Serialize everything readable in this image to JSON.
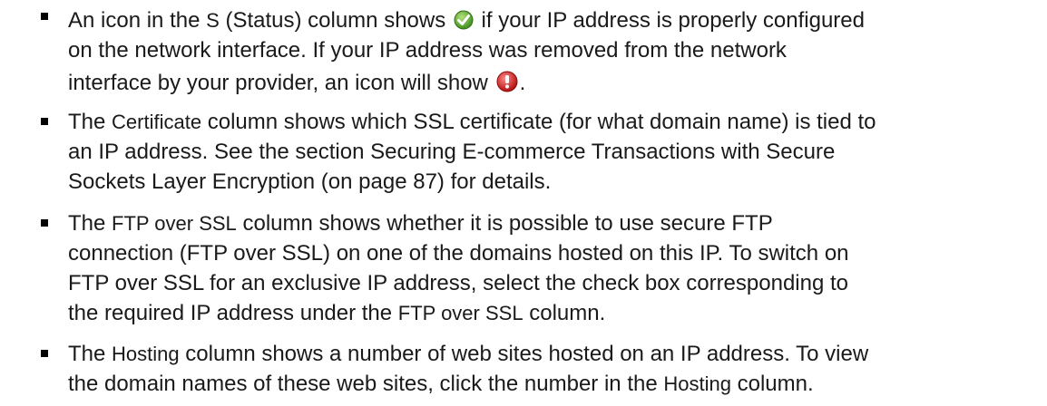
{
  "colors": {
    "ok_icon": "#5aa82e",
    "error_icon": "#cc1b1b"
  },
  "icons": {
    "status_ok": "green-check-icon",
    "status_error": "red-exclamation-icon"
  },
  "bullets": [
    {
      "lines": [
        {
          "parts": [
            "An icon in the ",
            "S",
            " (Status) column shows ",
            "",
            " if your IP address is properly configured"
          ]
        },
        {
          "text": "on the network interface. If your IP address was removed from the network"
        },
        {
          "parts": [
            "interface by your provider, an icon will show ",
            "",
            "."
          ]
        }
      ]
    },
    {
      "lines": [
        {
          "parts": [
            "The ",
            "Certificate",
            " column shows which SSL certificate (for what domain name) is tied to"
          ]
        },
        {
          "text": "an IP address. See the section Securing E-commerce Transactions with Secure"
        },
        {
          "text": "Sockets Layer Encryption (on page 87) for details."
        }
      ]
    },
    {
      "lines": [
        {
          "parts": [
            "The ",
            "FTP over SSL",
            " column shows whether it is possible to use secure FTP"
          ]
        },
        {
          "text": "connection (FTP over SSL) on one of the domains hosted on this IP. To switch on"
        },
        {
          "text": "FTP over SSL for an exclusive IP address, select the check box corresponding to"
        },
        {
          "parts": [
            "the required IP address under the ",
            "FTP over SSL",
            " column."
          ]
        }
      ]
    },
    {
      "lines": [
        {
          "parts": [
            "The ",
            "Hosting",
            " column shows a number of web sites hosted on an IP address. To view"
          ]
        },
        {
          "parts": [
            "the domain names of these web sites, click the number in the ",
            "Hosting",
            " column."
          ]
        }
      ]
    }
  ]
}
